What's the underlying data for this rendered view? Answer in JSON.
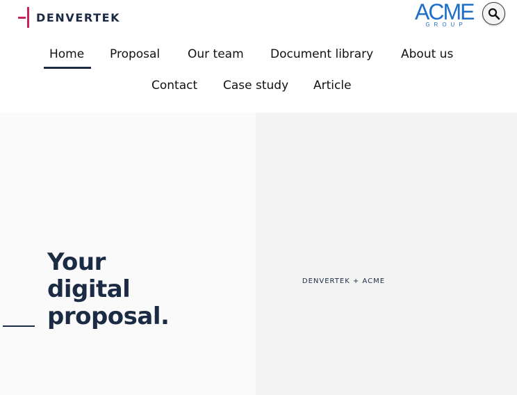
{
  "brand": {
    "logo_text": "DENVERTEK",
    "logo_accent_color": "#c8235b",
    "partner_logo_word": "ACME",
    "partner_logo_sub": "GROUP",
    "partner_logo_color": "#1f6fc9"
  },
  "header": {
    "search_icon": "search-icon"
  },
  "nav": {
    "items": [
      {
        "label": "Home",
        "active": true
      },
      {
        "label": "Proposal",
        "active": false
      },
      {
        "label": "Our team",
        "active": false
      },
      {
        "label": "Document library",
        "active": false
      },
      {
        "label": "About us",
        "active": false
      },
      {
        "label": "Contact",
        "active": false
      },
      {
        "label": "Case study",
        "active": false
      },
      {
        "label": "Article",
        "active": false
      }
    ]
  },
  "hero": {
    "title_lines": [
      "Your",
      "digital",
      "proposal."
    ],
    "partner_label": "DENVERTEK + ACME",
    "text_color": "#1c2b44"
  }
}
